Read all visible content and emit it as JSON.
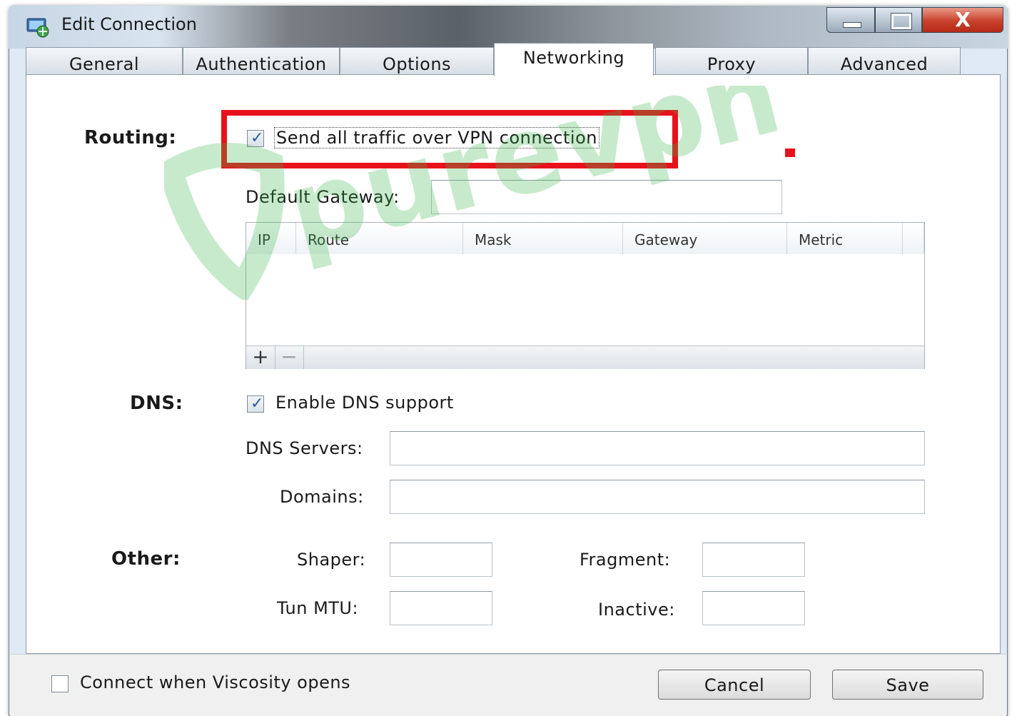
{
  "window": {
    "title": "Edit Connection",
    "close_glyph": "X",
    "icons": {
      "app": "network-connection-icon",
      "minimize": "minimize-icon",
      "maximize": "maximize-icon",
      "close": "close-icon"
    }
  },
  "tabs": [
    {
      "label": "General",
      "active": false
    },
    {
      "label": "Authentication",
      "active": false
    },
    {
      "label": "Options",
      "active": false
    },
    {
      "label": "Networking",
      "active": true
    },
    {
      "label": "Proxy",
      "active": false
    },
    {
      "label": "Advanced",
      "active": false
    }
  ],
  "routing": {
    "section_label": "Routing:",
    "send_all_traffic": {
      "label": "Send all traffic over VPN connection",
      "checked": true
    },
    "default_gateway": {
      "label": "Default Gateway:",
      "value": ""
    },
    "table": {
      "columns": [
        "IP",
        "Route",
        "Mask",
        "Gateway",
        "Metric"
      ],
      "rows": [],
      "add_glyph": "+",
      "remove_glyph": "−"
    }
  },
  "dns": {
    "section_label": "DNS:",
    "enable": {
      "label": "Enable DNS support",
      "checked": true
    },
    "servers": {
      "label": "DNS Servers:",
      "value": ""
    },
    "domains": {
      "label": "Domains:",
      "value": ""
    }
  },
  "other": {
    "section_label": "Other:",
    "shaper": {
      "label": "Shaper:",
      "value": ""
    },
    "tun_mtu": {
      "label": "Tun MTU:",
      "value": ""
    },
    "fragment": {
      "label": "Fragment:",
      "value": ""
    },
    "inactive": {
      "label": "Inactive:",
      "value": ""
    }
  },
  "footer": {
    "connect_on_open": {
      "label": "Connect when Viscosity opens",
      "checked": false
    },
    "cancel_label": "Cancel",
    "save_label": "Save"
  },
  "watermark": {
    "text": "purevpn"
  },
  "colors": {
    "highlight": "#e8121c",
    "watermark_green": "#3cb54a",
    "watermark_purple": "#6a3fb5",
    "checkmark": "#2c5da8"
  }
}
